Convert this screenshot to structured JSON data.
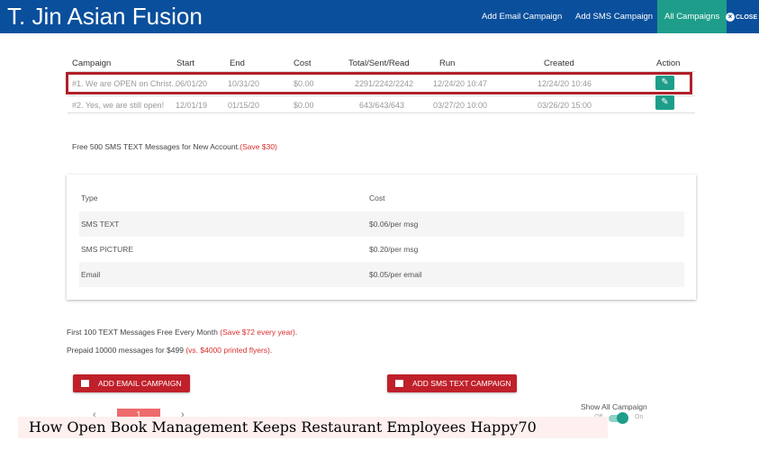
{
  "header": {
    "title": "T. Jin Asian Fusion",
    "nav": [
      "Add Email Campaign",
      "Add SMS Campaign",
      "All Campaigns"
    ],
    "close": "CLOSE",
    "accent": "#0a4f9c",
    "active_color": "#1e9e8a"
  },
  "table": {
    "headers": [
      "Campaign",
      "Start",
      "End",
      "Cost",
      "Total/Sent/Read",
      "Run",
      "Created",
      "Action"
    ],
    "rows": [
      [
        "#1. We are OPEN on Christ...",
        "06/01/20",
        "10/31/20",
        "$0.00",
        "2291/2242/2242",
        "12/24/20 10:47",
        "12/24/20 10:46"
      ],
      [
        "#2. Yes, we are still open!",
        "12/01/19",
        "01/15/20",
        "$0.00",
        "643/643/643",
        "03/27/20 10:00",
        "03/26/20 15:00"
      ]
    ]
  },
  "promo1": {
    "text": "Free 500 SMS TEXT Messages for New Account.",
    "save": "(Save $30)"
  },
  "pricing": {
    "headers": [
      "Type",
      "Cost"
    ],
    "rows": [
      [
        "SMS TEXT",
        "$0.06/per msg"
      ],
      [
        "SMS PICTURE",
        "$0.20/per msg"
      ],
      [
        "Email",
        "$0.05/per email"
      ]
    ]
  },
  "promo2": {
    "text": "First 100 TEXT Messages Free Every Month ",
    "save": "(Save $72 every year)",
    "end": "."
  },
  "promo3": {
    "text": "Prepaid 10000 messages for $499 ",
    "save": "(vs. $4000 printed flyers)",
    "end": "."
  },
  "buttons": {
    "email": "ADD EMAIL CAMPAIGN",
    "sms": "ADD SMS TEXT CAMPAIGN"
  },
  "pagination": {
    "current": "1",
    "prev": "‹",
    "next": "›"
  },
  "toggle": {
    "label": "Show All Campaign",
    "off": "Off",
    "on": "On",
    "state": true
  },
  "caption": "How Open Book Management Keeps Restaurant Employees Happy70"
}
